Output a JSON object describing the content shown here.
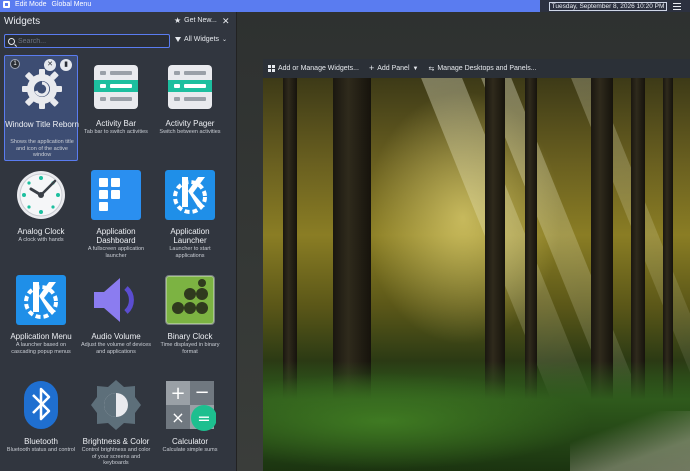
{
  "topbar": {
    "edit_mode": "Edit Mode",
    "global_menu": "Global Menu",
    "clock": "Tuesday, September 8, 2026 10:20 PM"
  },
  "panel": {
    "title": "Widgets",
    "get_new": "Get New...",
    "search_placeholder": "Search...",
    "filter": "All Widgets",
    "widgets": [
      {
        "name": "Window Title Reborn",
        "desc": "Shows the application title and icon of the active window",
        "selected": true,
        "badge": "1"
      },
      {
        "name": "Activity Bar",
        "desc": "Tab bar to switch activities"
      },
      {
        "name": "Activity Pager",
        "desc": "Switch between activities"
      },
      {
        "name": "Analog Clock",
        "desc": "A clock with hands"
      },
      {
        "name": "Application Dashboard",
        "desc": "A fullscreen application launcher"
      },
      {
        "name": "Application Launcher",
        "desc": "Launcher to start applications"
      },
      {
        "name": "Application Menu",
        "desc": "A launcher based on cascading popup menus"
      },
      {
        "name": "Audio Volume",
        "desc": "Adjust the volume of devices and applications"
      },
      {
        "name": "Binary Clock",
        "desc": "Time displayed in binary format"
      },
      {
        "name": "Bluetooth",
        "desc": "Bluetooth status and control"
      },
      {
        "name": "Brightness & Color",
        "desc": "Control brightness and color of your screens and keyboards"
      },
      {
        "name": "Calculator",
        "desc": "Calculate simple sums"
      }
    ]
  },
  "desktop_toolbar": {
    "add_widgets": "Add or Manage Widgets...",
    "add_panel": "Add Panel",
    "manage_desktops": "Manage Desktops and Panels..."
  },
  "colors": {
    "accent": "#5a7cf0",
    "panel_bg": "#31363f",
    "selected_bg": "#3d4d73"
  }
}
